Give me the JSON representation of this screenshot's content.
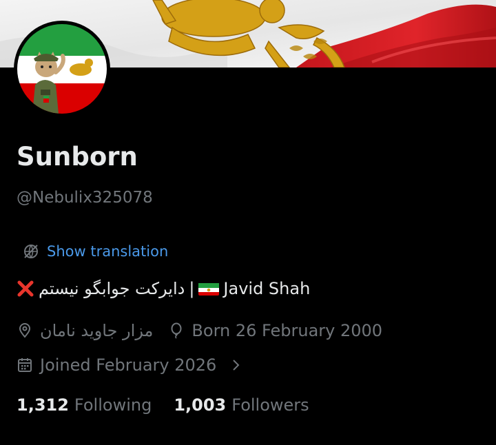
{
  "profile": {
    "display_name": "Sunborn",
    "handle": "@Nebulix325078",
    "show_translation_label": "Show translation",
    "bio": {
      "persian_text": "دایرکت جوابگو نیستم",
      "separator": "|",
      "name_text": "Javid Shah",
      "emoji_x": "cross-mark-emoji",
      "emoji_flag": "iran-lion-sun-flag"
    },
    "location": "مزار جاوید نامان",
    "birthday": "Born 26 February 2000",
    "joined": "Joined February 2026",
    "following": {
      "count": "1,312",
      "label": "Following"
    },
    "followers": {
      "count": "1,003",
      "label": "Followers"
    }
  },
  "colors": {
    "background": "#000000",
    "primary_text": "#e7e9ea",
    "secondary_text": "#71767b",
    "link": "#4a99e9",
    "flag_green": "#239f40",
    "flag_white": "#ffffff",
    "flag_red": "#da0000",
    "emblem_gold": "#d4a017"
  },
  "icons": {
    "translate": "translate-icon",
    "location": "location-pin-icon",
    "birthday": "balloon-icon",
    "joined": "calendar-icon",
    "joined_chevron": "chevron-right-icon"
  }
}
